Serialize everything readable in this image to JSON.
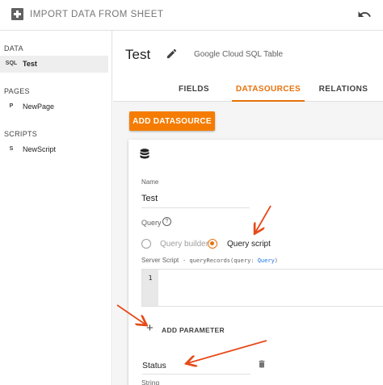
{
  "app": {
    "title": "IMPORT DATA FROM SHEET"
  },
  "sidebar": {
    "sections": [
      {
        "header": "DATA",
        "items": [
          {
            "prefix": "SQL",
            "label": "Test",
            "active": true
          }
        ]
      },
      {
        "header": "PAGES",
        "items": [
          {
            "prefix": "P",
            "label": "NewPage",
            "active": false
          }
        ]
      },
      {
        "header": "SCRIPTS",
        "items": [
          {
            "prefix": "S",
            "label": "NewScript",
            "active": false
          }
        ]
      }
    ]
  },
  "main": {
    "title": "Test",
    "subtitle": "Google Cloud SQL Table",
    "tabs": [
      {
        "label": "FIELDS",
        "active": false
      },
      {
        "label": "DATASOURCES",
        "active": true
      },
      {
        "label": "RELATIONS",
        "active": false
      }
    ],
    "add_datasource_label": "ADD DATASOURCE"
  },
  "datasource": {
    "name_label": "Name",
    "name_value": "Test",
    "query_label": "Query",
    "help_glyph": "?",
    "options": [
      {
        "label": "Query builder",
        "selected": false
      },
      {
        "label": "Query script",
        "selected": true
      }
    ],
    "server_script_label": "Server Script",
    "server_script_signature_prefix": "- queryRecords(query: ",
    "server_script_signature_type": "Query",
    "server_script_signature_suffix": ")",
    "editor_line_number": "1",
    "add_parameter_label": "ADD PARAMETER",
    "add_parameter_glyph": "+",
    "parameter": {
      "type_label": "String",
      "name": "Status"
    }
  },
  "colors": {
    "accent": "#e8710a",
    "button": "#f57c00",
    "annotation_arrow": "#e64a19"
  },
  "icons": [
    "app-icon",
    "undo-icon",
    "edit-icon",
    "database-icon",
    "help-icon",
    "plus-icon",
    "trash-icon"
  ]
}
